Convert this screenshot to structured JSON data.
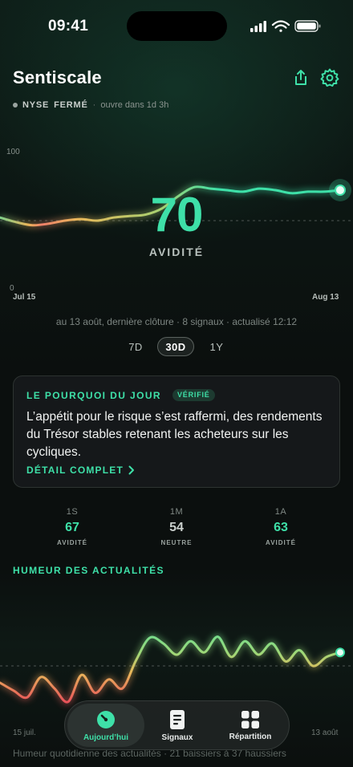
{
  "status_bar": {
    "time": "09:41"
  },
  "header": {
    "title": "Sentiscale",
    "market_exchange": "NYSE",
    "market_state": "FERMÉ",
    "market_separator": "·",
    "market_opens": "ouvre dans 1d 3h"
  },
  "gauge": {
    "score": "70",
    "label": "AVIDITÉ",
    "y_max_label": "100",
    "y_min_label": "0",
    "x_start_label": "Jul 15",
    "x_end_label": "Aug 13"
  },
  "chart_data": {
    "type": "line",
    "x": [
      "Jul 15",
      "Jul 16",
      "Jul 17",
      "Jul 18",
      "Jul 19",
      "Jul 22",
      "Jul 23",
      "Jul 24",
      "Jul 25",
      "Jul 26",
      "Jul 29",
      "Jul 30",
      "Jul 31",
      "Aug 1",
      "Aug 2",
      "Aug 5",
      "Aug 6",
      "Aug 7",
      "Aug 8",
      "Aug 9",
      "Aug 12",
      "Aug 13"
    ],
    "series": [
      {
        "values": [
          52,
          49,
          47,
          48,
          50,
          51,
          50,
          52,
          53,
          54,
          58,
          66,
          72,
          71,
          70,
          69,
          71,
          70,
          68,
          69,
          69,
          70
        ]
      }
    ],
    "ylim": [
      0,
      100
    ],
    "reference_line": 50
  },
  "meta": "au 13 août, dernière clôture · 8 signaux · actualisé 12:12",
  "ranges": {
    "r7d": "7D",
    "r30d": "30D",
    "r1y": "1Y",
    "selected": "30D"
  },
  "card": {
    "title": "LE POURQUOI DU JOUR",
    "badge": "VÉRIFIÉ",
    "body": "L’appétit pour le risque s’est raffermi, des rendements du Trésor stables retenant les acheteurs sur les cycliques.",
    "link": "DÉTAIL COMPLET"
  },
  "stats": [
    {
      "period": "1S",
      "value": "67",
      "label": "AVIDITÉ"
    },
    {
      "period": "1M",
      "value": "54",
      "label": "NEUTRE"
    },
    {
      "period": "1A",
      "value": "63",
      "label": "AVIDITÉ"
    }
  ],
  "news": {
    "title": "HUMEUR DES ACTUALITÉS",
    "start_label": "15 juil.",
    "end_label": "13 août",
    "caption": "Humeur quotidienne des actualités · 21 baissiers à 37 haussiers",
    "values": [
      35,
      28,
      22,
      40,
      30,
      18,
      42,
      26,
      38,
      30,
      55,
      75,
      70,
      60,
      72,
      62,
      76,
      58,
      72,
      60,
      70,
      54,
      64,
      50,
      58,
      62
    ]
  },
  "tabs": [
    {
      "label": "Aujourd’hui"
    },
    {
      "label": "Signaux"
    },
    {
      "label": "Répartition"
    }
  ],
  "colors": {
    "accent": "#3ee0a8",
    "fear": "#e8455a",
    "neutral": "#e9b85a"
  }
}
